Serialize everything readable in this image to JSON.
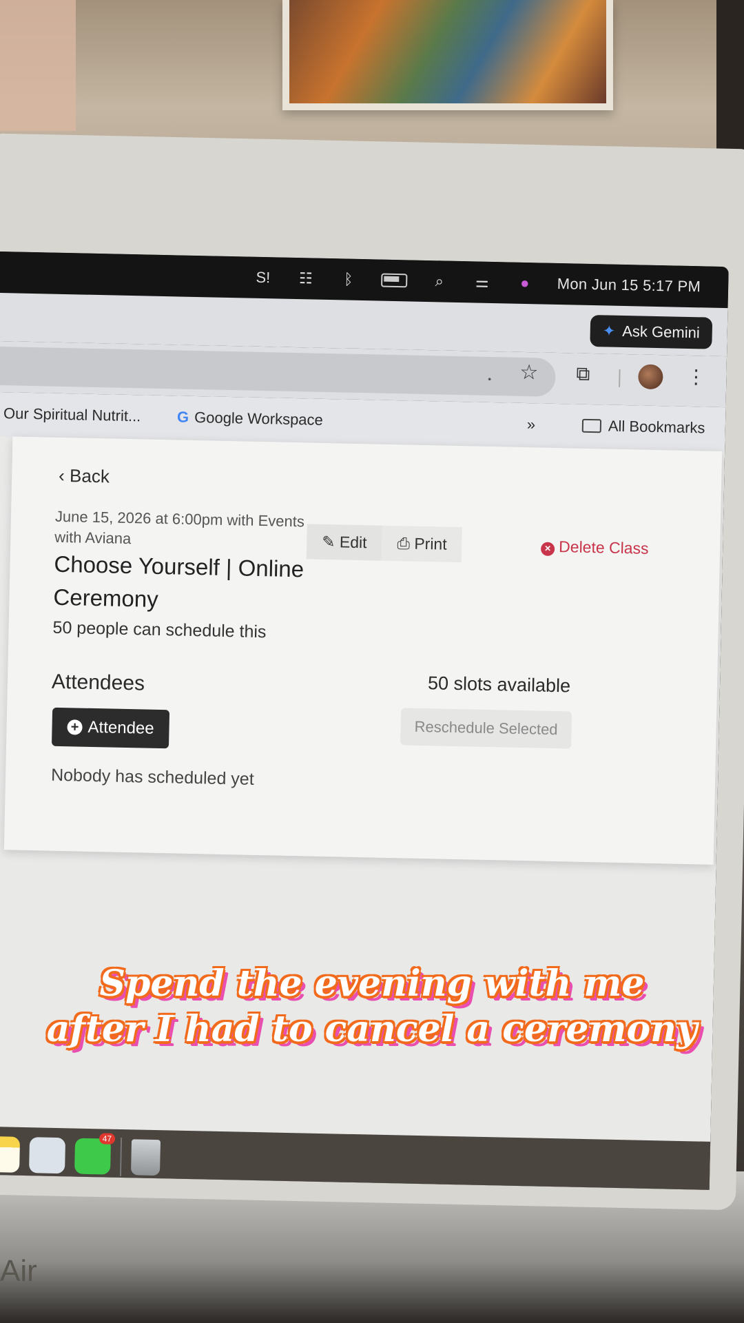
{
  "menubar": {
    "clock": "Mon Jun 15  5:17 PM"
  },
  "chrome": {
    "gemini_label": "Ask Gemini",
    "bookmarks": [
      {
        "label": "Our Spiritual Nutrit..."
      },
      {
        "label": "Google Workspace"
      }
    ],
    "overflow": "»",
    "all_bookmarks": "All Bookmarks"
  },
  "event": {
    "back_label": "Back",
    "meta": "June 15, 2026 at 6:00pm with Events with Aviana",
    "title": "Choose Yourself | Online Ceremony",
    "capacity": "50 people can schedule this",
    "edit_label": "Edit",
    "print_label": "Print",
    "delete_label": "Delete Class",
    "attendees_heading": "Attendees",
    "slots": "50 slots available",
    "add_attendee_label": "Attendee",
    "reschedule_label": "Reschedule Selected",
    "empty_text": "Nobody has scheduled yet"
  },
  "dock": {
    "messages_badge": "47"
  },
  "caption": {
    "line1": "Spend the evening with me",
    "line2": "after I had to cancel a ceremony"
  },
  "laptop_label": "Air",
  "colors": {
    "delete": "#c8354a",
    "caption_outline": "#f26b1d",
    "caption_shadow": "#e84fb0"
  }
}
